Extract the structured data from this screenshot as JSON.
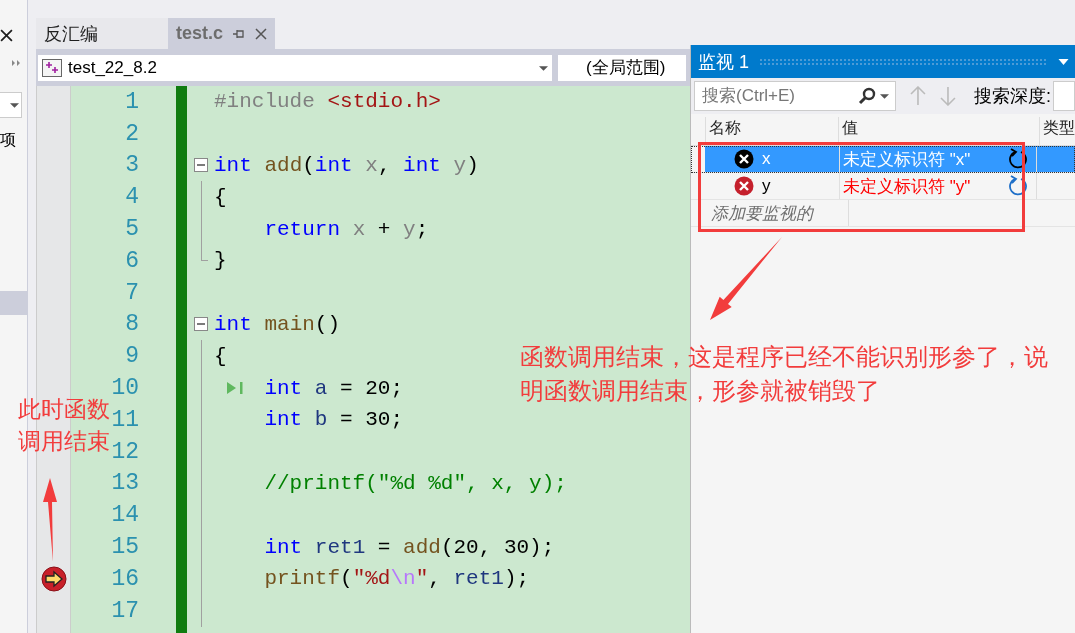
{
  "side_panel": {
    "label": "项"
  },
  "tabs": [
    {
      "label": "反汇编",
      "selected": false
    },
    {
      "label": "test.c",
      "selected": true
    }
  ],
  "nav_bar": {
    "project": "test_22_8.2",
    "scope": "(全局范围)"
  },
  "code_lines": [
    {
      "number": "1",
      "kind": "plain",
      "tokens": [
        {
          "kind": "pre",
          "text": "#include "
        },
        {
          "kind": "str",
          "text": "<stdio.h>"
        }
      ]
    },
    {
      "number": "2",
      "kind": "plain"
    },
    {
      "number": "3",
      "kind": "fold_start",
      "tokens": [
        {
          "kind": "kw",
          "text": "int "
        },
        {
          "kind": "fn",
          "text": "add"
        },
        {
          "kind": "plain",
          "text": "("
        },
        {
          "kind": "kw",
          "text": "int "
        },
        {
          "kind": "param",
          "text": "x"
        },
        {
          "kind": "plain",
          "text": ", "
        },
        {
          "kind": "kw",
          "text": "int "
        },
        {
          "kind": "param",
          "text": "y"
        },
        {
          "kind": "plain",
          "text": ")"
        }
      ]
    },
    {
      "number": "4",
      "kind": "fold_body",
      "tokens": [
        {
          "kind": "plain",
          "text": "{"
        }
      ]
    },
    {
      "number": "5",
      "kind": "fold_body",
      "indented": true,
      "tokens": [
        {
          "kind": "kw",
          "text": "return "
        },
        {
          "kind": "param",
          "text": "x"
        },
        {
          "kind": "plain",
          "text": " + "
        },
        {
          "kind": "param",
          "text": "y"
        },
        {
          "kind": "plain",
          "text": ";"
        }
      ]
    },
    {
      "number": "6",
      "kind": "fold_end",
      "tokens": [
        {
          "kind": "plain",
          "text": "}"
        }
      ]
    },
    {
      "number": "7",
      "kind": "plain"
    },
    {
      "number": "8",
      "kind": "fold_start",
      "tokens": [
        {
          "kind": "kw",
          "text": "int "
        },
        {
          "kind": "fn",
          "text": "main"
        },
        {
          "kind": "plain",
          "text": "()"
        }
      ]
    },
    {
      "number": "9",
      "kind": "fold_body",
      "tokens": [
        {
          "kind": "plain",
          "text": "{"
        }
      ]
    },
    {
      "number": "10",
      "kind": "fold_body",
      "indented": true,
      "run_to_click": true,
      "tokens": [
        {
          "kind": "kw",
          "text": "int "
        },
        {
          "kind": "local",
          "text": "a"
        },
        {
          "kind": "plain",
          "text": " = 20;"
        }
      ]
    },
    {
      "number": "11",
      "kind": "fold_body",
      "indented": true,
      "tokens": [
        {
          "kind": "kw",
          "text": "int "
        },
        {
          "kind": "local",
          "text": "b"
        },
        {
          "kind": "plain",
          "text": " = 30;"
        }
      ]
    },
    {
      "number": "12",
      "kind": "fold_body"
    },
    {
      "number": "13",
      "kind": "fold_body",
      "indented": true,
      "tokens": [
        {
          "kind": "cmt",
          "text": "//printf(\"%d %d\", x, y);"
        }
      ]
    },
    {
      "number": "14",
      "kind": "fold_body"
    },
    {
      "number": "15",
      "kind": "fold_body",
      "indented": true,
      "tokens": [
        {
          "kind": "kw",
          "text": "int "
        },
        {
          "kind": "local",
          "text": "ret1"
        },
        {
          "kind": "plain",
          "text": " = "
        },
        {
          "kind": "fn",
          "text": "add"
        },
        {
          "kind": "plain",
          "text": "(20, 30);"
        }
      ]
    },
    {
      "number": "16",
      "kind": "fold_body",
      "indented": true,
      "current": true,
      "tokens": [
        {
          "kind": "fn",
          "text": "printf"
        },
        {
          "kind": "plain",
          "text": "("
        },
        {
          "kind": "str",
          "text": "\"%d"
        },
        {
          "kind": "esc",
          "text": "\\n"
        },
        {
          "kind": "str",
          "text": "\""
        },
        {
          "kind": "plain",
          "text": ", "
        },
        {
          "kind": "local",
          "text": "ret1"
        },
        {
          "kind": "plain",
          "text": ");"
        }
      ]
    },
    {
      "number": "17",
      "kind": "fold_body"
    }
  ],
  "watch": {
    "title": "监视 1",
    "search_placeholder": "搜索(Ctrl+E)",
    "depth_label": "搜索深度:",
    "columns": [
      "名称",
      "值",
      "类型"
    ],
    "rows": [
      {
        "name": "x",
        "value": "未定义标识符 \"x\"",
        "selected": true
      },
      {
        "name": "y",
        "value": "未定义标识符 \"y\"",
        "selected": false
      }
    ],
    "add_hint": "添加要监视的"
  },
  "annotations": {
    "left_note": "此时函数调用结束",
    "right_note": "函数调用结束，这是程序已经不能识别形参了，说明函数调用结束，形参就被销毁了"
  }
}
